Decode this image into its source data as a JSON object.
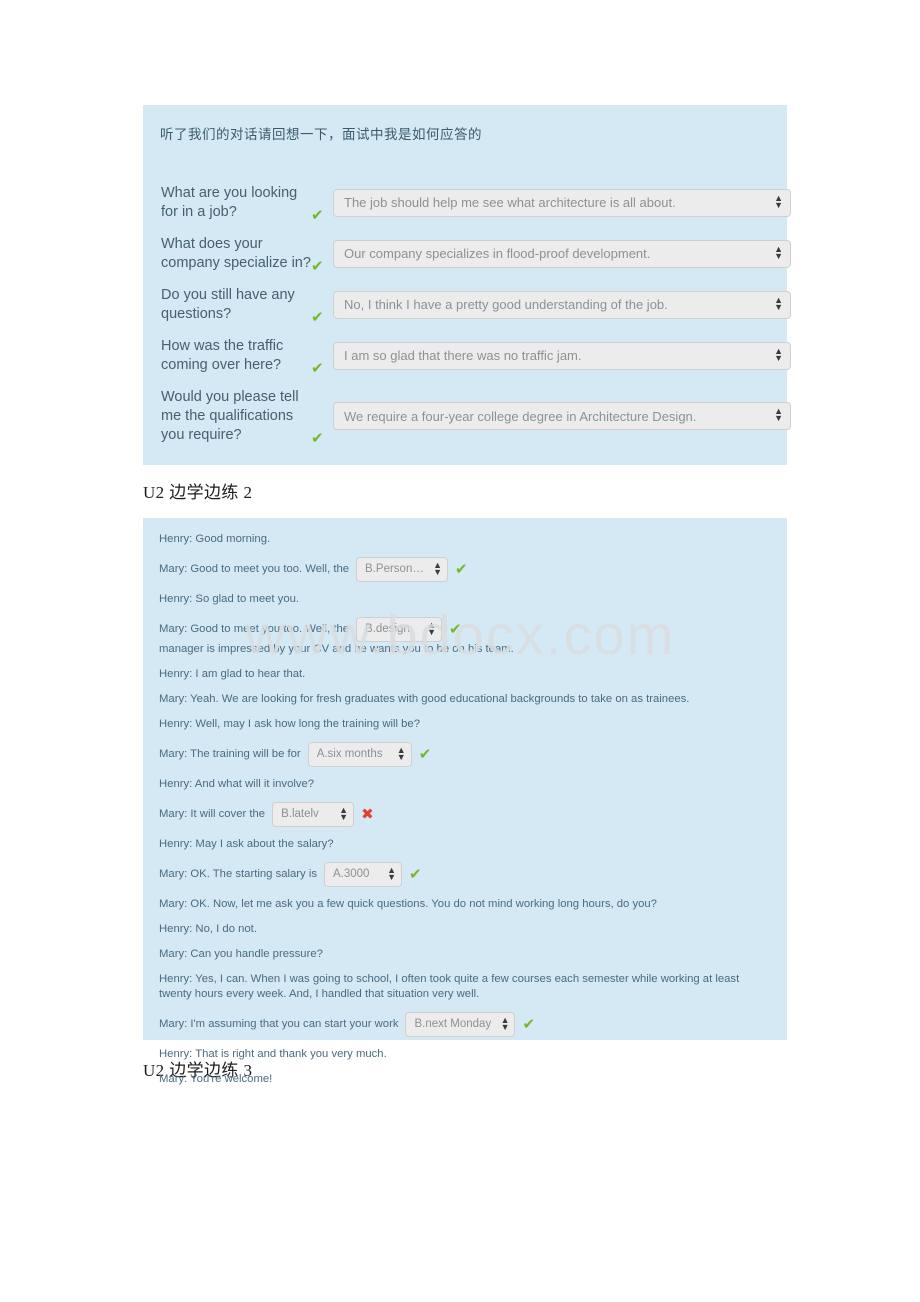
{
  "watermark": "www.bdocx.com",
  "quiz": {
    "prompt": "听了我们的对话请回想一下，面试中我是如何应答的",
    "rows": [
      {
        "question": "What are you looking for in a job?",
        "answer": "The job should help me see what architecture is all about.",
        "status": "correct",
        "status_glyph": "✔"
      },
      {
        "question": "What does your company specialize in?",
        "answer": "Our company specializes in flood-proof development.",
        "status": "correct",
        "status_glyph": "✔"
      },
      {
        "question": "Do you still have any questions?",
        "answer": "No, I think I have a pretty good understanding of the job.",
        "status": "correct",
        "status_glyph": "✔"
      },
      {
        "question": "How was the traffic coming over here?",
        "answer": "I am so glad that there was no traffic jam.",
        "status": "correct",
        "status_glyph": "✔"
      },
      {
        "question": "Would you please tell me the qualifications you require?",
        "answer": "We require a four-year college degree in Architecture Design.",
        "status": "correct",
        "status_glyph": "✔"
      }
    ]
  },
  "caption_2": "U2 边学边练 2",
  "caption_3": "U2 边学边练 3",
  "dialogue": {
    "lines": [
      {
        "type": "plain",
        "text": "Henry: Good morning."
      },
      {
        "type": "select",
        "before": "Mary: Good to meet you too. Well, the",
        "value": "B.Personnel",
        "status": "correct",
        "status_glyph": "✔",
        "after": ""
      },
      {
        "type": "plain",
        "text": "Henry: So glad to meet you."
      },
      {
        "type": "select",
        "before": "Mary: Good to meet you too. Well, the",
        "value": "B.design",
        "status": "correct",
        "status_glyph": "✔",
        "after": "manager is impressed by your CV and he wants you to be on his team."
      },
      {
        "type": "plain",
        "text": "Henry: I am glad to hear that."
      },
      {
        "type": "plain",
        "text": "Mary: Yeah. We are looking for fresh graduates with good educational backgrounds to take on as trainees."
      },
      {
        "type": "plain",
        "text": "Henry: Well, may I ask how long the training will be?"
      },
      {
        "type": "select",
        "before": "Mary: The training will be for",
        "value": "A.six months",
        "status": "correct",
        "status_glyph": "✔",
        "after": ""
      },
      {
        "type": "plain",
        "text": "Henry: And what will it involve?"
      },
      {
        "type": "select",
        "before": "Mary: It will cover the",
        "value": "B.latelv",
        "status": "wrong",
        "status_glyph": "✖",
        "after": ""
      },
      {
        "type": "plain",
        "text": "Henry: May I ask about the salary?"
      },
      {
        "type": "select",
        "before": "Mary: OK. The starting salary is",
        "value": "A.3000",
        "status": "correct",
        "status_glyph": "✔",
        "after": ""
      },
      {
        "type": "plain",
        "text": "Mary: OK. Now, let me ask you a few quick questions. You do not mind working long hours, do you?"
      },
      {
        "type": "plain",
        "text": "Henry: No, I do not."
      },
      {
        "type": "plain",
        "text": "Mary: Can you handle pressure?"
      },
      {
        "type": "plain",
        "text": "Henry: Yes, I can. When I was going to school, I often took quite a few courses each semester while working at least twenty hours every week. And, I handled that situation very well."
      },
      {
        "type": "select",
        "before": "Mary: I'm assuming that you can start your work",
        "value": "B.next Monday",
        "status": "correct",
        "status_glyph": "✔",
        "after": ""
      },
      {
        "type": "plain",
        "text": "Henry: That is right and thank you very much."
      },
      {
        "type": "plain",
        "text": "Mary: You're welcome!"
      }
    ]
  },
  "colors": {
    "panel_background": "#d4e9f4",
    "select_background": "#ececec",
    "select_border": "#cfcfcf",
    "text": "#46606f",
    "correct": "#76b72a",
    "wrong": "#e8402a",
    "watermark": "#d9dde0"
  }
}
